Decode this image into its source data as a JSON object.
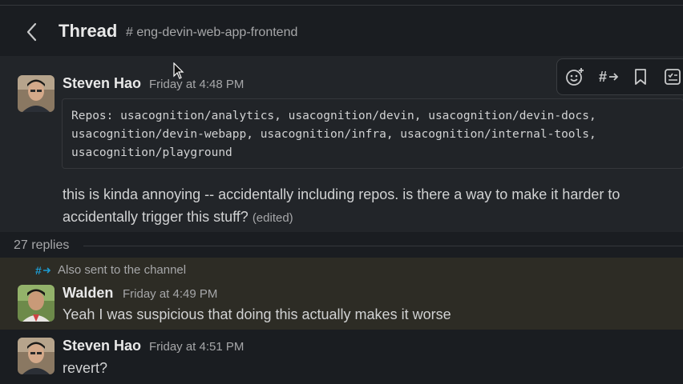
{
  "header": {
    "back_icon": "chevron-left-icon",
    "title": "Thread",
    "channel": "# eng-devin-web-app-frontend"
  },
  "parent_message": {
    "author": "Steven Hao",
    "timestamp": "Friday at 4:48 PM",
    "code_lines": [
      "Repos: usacognition/analytics, usacognition/devin, usacognition/devin-docs,",
      "usacognition/devin-webapp, usacognition/infra, usacognition/internal-tools,",
      "usacognition/playground"
    ],
    "text_line1": "this is kinda annoying -- accidentally including repos. is there a way to make it harder to",
    "text_line2": "accidentally trigger this stuff?",
    "edited": "(edited)"
  },
  "toolbar": {
    "icons": [
      "emoji-add-icon",
      "share-channel-icon",
      "bookmark-icon",
      "add-to-list-icon"
    ]
  },
  "replies": {
    "count_label": "27 replies"
  },
  "reply_1": {
    "also_sent": "Also sent to the channel",
    "author": "Walden",
    "timestamp": "Friday at 4:49 PM",
    "text": "Yeah I was suspicious that doing this actually makes it worse"
  },
  "reply_2": {
    "author": "Steven Hao",
    "timestamp": "Friday at 4:51 PM",
    "text": "revert?"
  },
  "colors": {
    "background": "#1a1d21",
    "hover_background": "#222529",
    "highlight_background": "#2d2c25",
    "accent_blue": "#1d9bd1"
  }
}
